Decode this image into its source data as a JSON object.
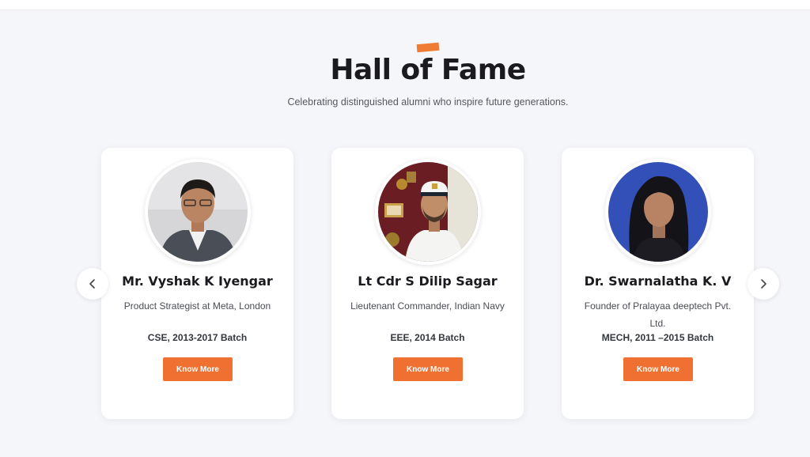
{
  "section": {
    "title": "Hall of Fame",
    "subtitle": "Celebrating distinguished alumni who inspire future generations.",
    "accent_color": "#f07b32"
  },
  "carousel": {
    "prev_icon": "chevron-left-icon",
    "next_icon": "chevron-right-icon"
  },
  "alumni": [
    {
      "name": "Mr. Vyshak K Iyengar",
      "role": "Product Strategist at Meta, London",
      "batch": "CSE, 2013-2017 Batch",
      "button": "Know More"
    },
    {
      "name": "Lt Cdr S Dilip Sagar",
      "role": "Lieutenant Commander, Indian Navy",
      "batch": "EEE, 2014 Batch",
      "button": "Know More"
    },
    {
      "name": "Dr. Swarnalatha K. V",
      "role": "Founder of Pralayaa deeptech Pvt. Ltd.",
      "batch": "MECH, 2011 –2015 Batch",
      "button": "Know More"
    }
  ]
}
